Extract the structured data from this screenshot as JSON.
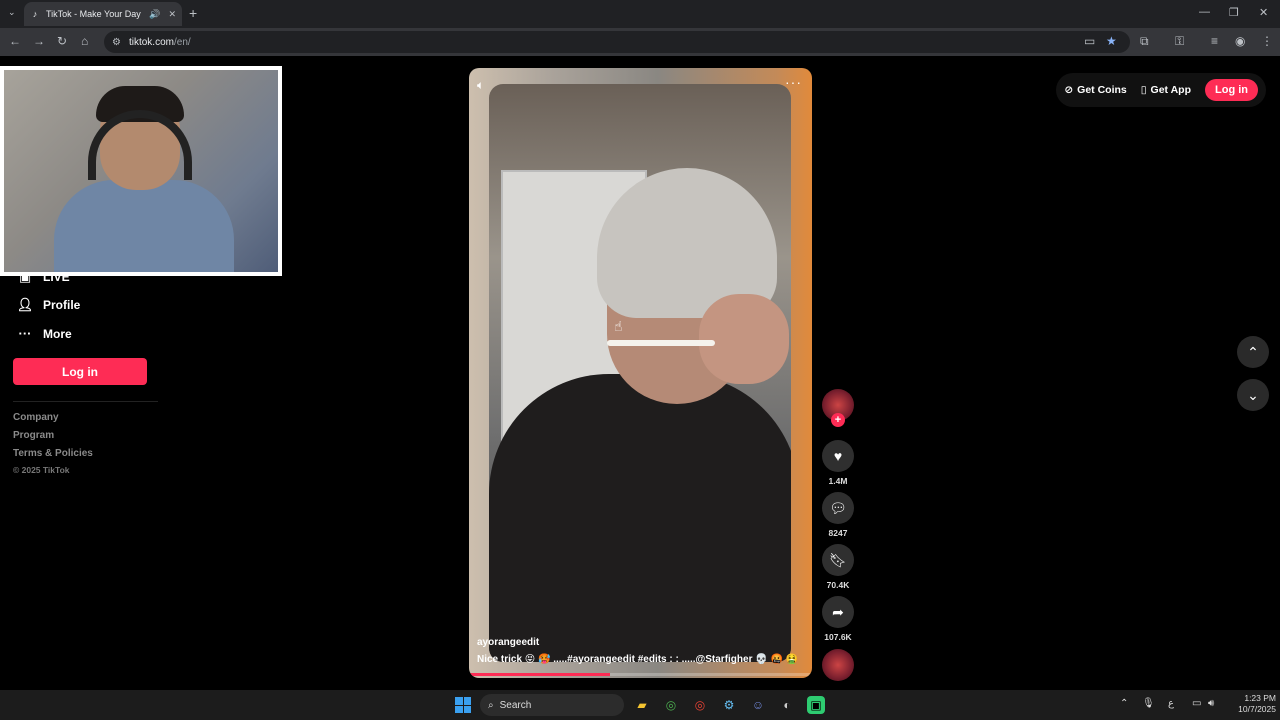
{
  "browser": {
    "tab_title": "TikTok - Make Your Day",
    "url_domain": "tiktok.com",
    "url_path": "/en/"
  },
  "sidebar": {
    "items": [
      {
        "label": "LIVE",
        "icon": "live-icon"
      },
      {
        "label": "Profile",
        "icon": "person-icon"
      },
      {
        "label": "More",
        "icon": "more-dots-icon"
      }
    ],
    "login_label": "Log in",
    "footer_links": [
      "Company",
      "Program",
      "Terms & Policies"
    ],
    "copyright": "© 2025 TikTok"
  },
  "video": {
    "author": "ayorangeedit",
    "caption": "Nice trick 😝 🥵 .....#ayorangeedit  #edits   : : .....@Starfigher 💀 🤬 🤮",
    "progress_percent": 41,
    "likes": "1.4M",
    "comments": "8247",
    "saves": "70.4K",
    "shares": "107.6K"
  },
  "topbar": {
    "get_coins": "Get Coins",
    "get_app": "Get App",
    "login": "Log in"
  },
  "taskbar": {
    "search_label": "Search",
    "time": "1:23 PM",
    "date": "10/7/2025"
  },
  "colors": {
    "brand": "#fe2c55",
    "background": "#000000"
  }
}
